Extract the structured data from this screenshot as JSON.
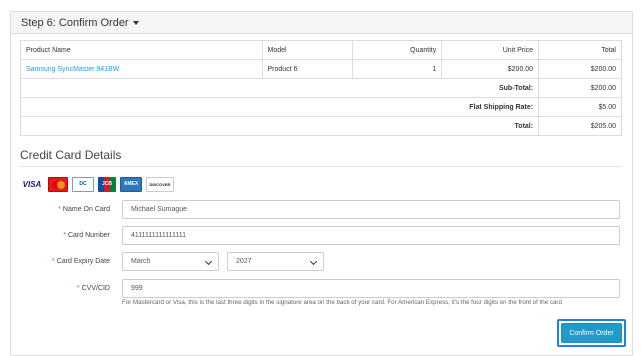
{
  "panel": {
    "heading": "Step 6: Confirm Order"
  },
  "cart": {
    "headers": {
      "product_name": "Product Name",
      "model": "Model",
      "quantity": "Quantity",
      "unit_price": "Unit Price",
      "total": "Total"
    },
    "items": [
      {
        "product_name": "Samsung SyncMaster 941BW",
        "model": "Product 6",
        "quantity": "1",
        "unit_price": "$200.00",
        "total": "$200.00"
      }
    ],
    "totals": [
      {
        "label": "Sub-Total:",
        "value": "$200.00"
      },
      {
        "label": "Flat Shipping Rate:",
        "value": "$5.00"
      },
      {
        "label": "Total:",
        "value": "$205.00"
      }
    ]
  },
  "credit_card": {
    "title": "Credit Card Details",
    "card_logos": [
      {
        "name": "visa-logo",
        "text": "VISA"
      },
      {
        "name": "mastercard-logo",
        "text": ""
      },
      {
        "name": "diners-club-logo",
        "text": "DC"
      },
      {
        "name": "jcb-logo",
        "text": "JCB"
      },
      {
        "name": "american-express-logo",
        "text": "AMEX"
      },
      {
        "name": "discover-logo",
        "text": "DISCOVER"
      }
    ],
    "fields": {
      "name_on_card": {
        "label": "Name On Card",
        "value": "Michael Sumague"
      },
      "card_number": {
        "label": "Card Number",
        "value": "4111111111111111"
      },
      "expiry": {
        "label": "Card Expiry Date",
        "month": "March",
        "year": "2027"
      },
      "cvv": {
        "label": "CVV/CID",
        "value": "999"
      }
    },
    "help_text": "For Mastercard or Visa, this is the last three digits in the signature area on the back of your card. For American Express, it's the four digits on the front of the card"
  },
  "actions": {
    "confirm_label": "Confirm Order"
  },
  "colors": {
    "link": "#23a1d1",
    "button": "#229ac8",
    "required": "#d9534f",
    "focus_outline": "#1e80e0"
  }
}
